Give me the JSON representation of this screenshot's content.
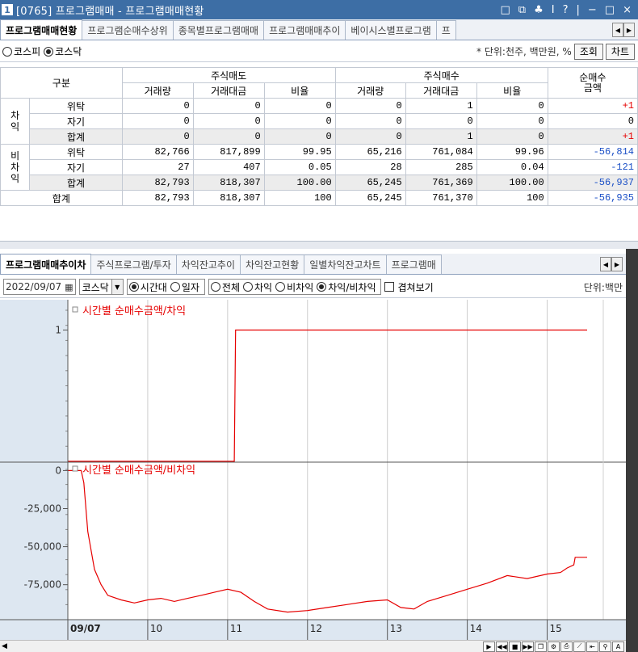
{
  "window": {
    "number": "1",
    "title": "[0765] 프로그램매매 - 프로그램매매현황",
    "controls": [
      "□",
      "⧉",
      "♣",
      "I",
      "?",
      "|",
      "−",
      "□",
      "×"
    ]
  },
  "top_tabs": [
    "프로그램매매현황",
    "프로그램순매수상위",
    "종목별프로그램매매",
    "프로그램매매추이",
    "베이시스별프로그램",
    "프"
  ],
  "market_options": {
    "kospi": "코스피",
    "kosdaq": "코스닥",
    "selected": "kosdaq"
  },
  "unit_label": "* 단위:천주, 백만원, %",
  "buttons": {
    "query": "조회",
    "chart": "차트"
  },
  "table": {
    "header": {
      "category": "구분",
      "sell_group": "주식매도",
      "buy_group": "주식매수",
      "net_line1": "순매수",
      "net_line2": "금액",
      "sub": [
        "거래량",
        "거래대금",
        "비율",
        "거래량",
        "거래대금",
        "비율"
      ]
    },
    "groups": [
      {
        "label": "차\n익",
        "rows": [
          {
            "name": "위탁",
            "values": [
              "0",
              "0",
              "0",
              "0",
              "1",
              "0"
            ],
            "net": "+1",
            "net_color": "red"
          },
          {
            "name": "자기",
            "values": [
              "0",
              "0",
              "0",
              "0",
              "0",
              "0"
            ],
            "net": "0",
            "net_color": "black"
          },
          {
            "name": "합계",
            "values": [
              "0",
              "0",
              "0",
              "0",
              "1",
              "0"
            ],
            "net": "+1",
            "net_color": "red",
            "sum": true
          }
        ]
      },
      {
        "label": "비\n차\n익",
        "rows": [
          {
            "name": "위탁",
            "values": [
              "82,766",
              "817,899",
              "99.95",
              "65,216",
              "761,084",
              "99.96"
            ],
            "net": "-56,814",
            "net_color": "blue"
          },
          {
            "name": "자기",
            "values": [
              "27",
              "407",
              "0.05",
              "28",
              "285",
              "0.04"
            ],
            "net": "-121",
            "net_color": "blue"
          },
          {
            "name": "합계",
            "values": [
              "82,793",
              "818,307",
              "100.00",
              "65,245",
              "761,369",
              "100.00"
            ],
            "net": "-56,937",
            "net_color": "blue",
            "sum": true
          }
        ]
      }
    ],
    "total": {
      "name": "합계",
      "values": [
        "82,793",
        "818,307",
        "100",
        "65,245",
        "761,370",
        "100"
      ],
      "net": "-56,935",
      "net_color": "blue"
    }
  },
  "bottom_tabs": [
    "프로그램매매추이차",
    "주식프로그램/투자",
    "차익잔고추이",
    "차익잔고현황",
    "일별차익잔고차트",
    "프로그램매"
  ],
  "controls": {
    "date": "2022/09/07",
    "market": "코스닥",
    "time_opts": {
      "time": "시간대",
      "day": "일자",
      "selected": "time"
    },
    "filter_opts": {
      "all": "전체",
      "arb": "차익",
      "nonarb": "비차익",
      "both": "차익/비차익",
      "selected": "both"
    },
    "overlap": "겹쳐보기",
    "unit": "단위:백만"
  },
  "colors": {
    "accent": "#3d6ea5",
    "series": "#e60000",
    "up": "#e60000",
    "down": "#1a4fc6"
  },
  "chart_data": [
    {
      "type": "line",
      "title": "시간별 순매수금액/차익",
      "y_ticks": [
        "1"
      ],
      "ylim": [
        0,
        1.2
      ],
      "x_ticks": [
        "09/07",
        "10",
        "11",
        "12",
        "13",
        "14",
        "15"
      ],
      "series": [
        {
          "name": "시간별 순매수금액/차익",
          "color": "#e60000",
          "x": [
            "09:00",
            "11:05",
            "11:06",
            "15:30"
          ],
          "values": [
            0,
            0,
            1,
            1
          ]
        }
      ]
    },
    {
      "type": "line",
      "title": "시간별 순매수금액/비차익",
      "y_ticks": [
        "0",
        "-25,000",
        "-50,000",
        "-75,000"
      ],
      "ylim": [
        -98000,
        5000
      ],
      "x_ticks": [
        "09/07",
        "10",
        "11",
        "12",
        "13",
        "14",
        "15"
      ],
      "series": [
        {
          "name": "시간별 순매수금액/비차익",
          "color": "#e60000",
          "x": [
            "09:00",
            "09:10",
            "09:12",
            "09:15",
            "09:20",
            "09:25",
            "09:30",
            "09:40",
            "09:50",
            "10:00",
            "10:10",
            "10:20",
            "10:30",
            "10:40",
            "10:50",
            "11:00",
            "11:10",
            "11:20",
            "11:30",
            "11:45",
            "12:00",
            "12:15",
            "12:30",
            "12:45",
            "13:00",
            "13:10",
            "13:20",
            "13:30",
            "13:45",
            "14:00",
            "14:15",
            "14:30",
            "14:45",
            "15:00",
            "15:10",
            "15:15",
            "15:20",
            "15:21",
            "15:30"
          ],
          "values": [
            0,
            0,
            -8000,
            -40000,
            -65000,
            -75000,
            -82000,
            -85000,
            -87000,
            -85000,
            -84000,
            -86000,
            -84000,
            -82000,
            -80000,
            -78000,
            -80000,
            -86000,
            -91000,
            -93000,
            -92000,
            -90000,
            -88000,
            -86000,
            -85000,
            -90000,
            -91000,
            -86000,
            -82000,
            -78000,
            -74000,
            -69000,
            -71000,
            -68000,
            -67000,
            -64000,
            -62000,
            -57000,
            -57000
          ]
        }
      ]
    }
  ]
}
